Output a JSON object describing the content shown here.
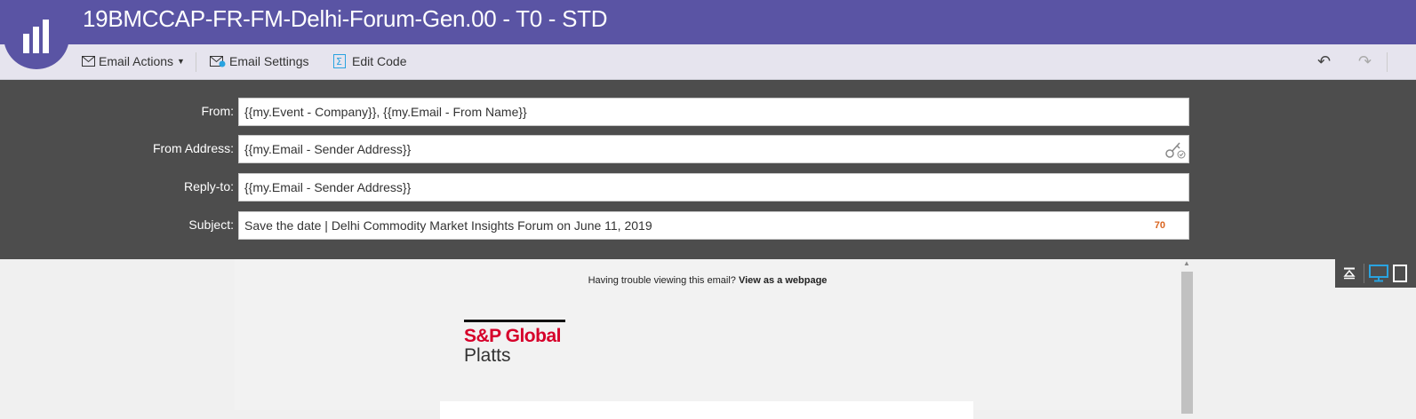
{
  "window": {
    "title": "19BMCCAP-FR-FM-Delhi-Forum-Gen.00 - T0 - STD"
  },
  "toolbar": {
    "email_actions": "Email Actions",
    "email_settings": "Email Settings",
    "edit_code": "Edit Code"
  },
  "header_fields": {
    "from": {
      "label": "From:",
      "value": "{{my.Event - Company}}, {{my.Email - From Name}}"
    },
    "from_address": {
      "label": "From Address:",
      "value": "{{my.Email - Sender Address}}"
    },
    "reply_to": {
      "label": "Reply-to:",
      "value": "{{my.Email - Sender Address}}"
    },
    "subject": {
      "label": "Subject:",
      "value": "Save the date | Delhi Commodity Market Insights Forum on June 11, 2019",
      "char_count": "70"
    }
  },
  "preview": {
    "trouble_text": "Having trouble viewing this email?",
    "webpage_link": "View as a webpage",
    "logo_line1": "S&P Global",
    "logo_line2": "Platts"
  },
  "colors": {
    "brand_purple": "#5a54a4",
    "panel_dark": "#4d4d4d",
    "count_orange": "#d9641f",
    "sp_red": "#d6002a",
    "device_active": "#29a3e0"
  },
  "icons": [
    "logo-icon",
    "envelope-icon",
    "envelope-settings-icon",
    "code-icon",
    "undo-icon",
    "redo-icon",
    "key-icon",
    "collapse-icon",
    "desktop-icon",
    "tablet-icon"
  ]
}
